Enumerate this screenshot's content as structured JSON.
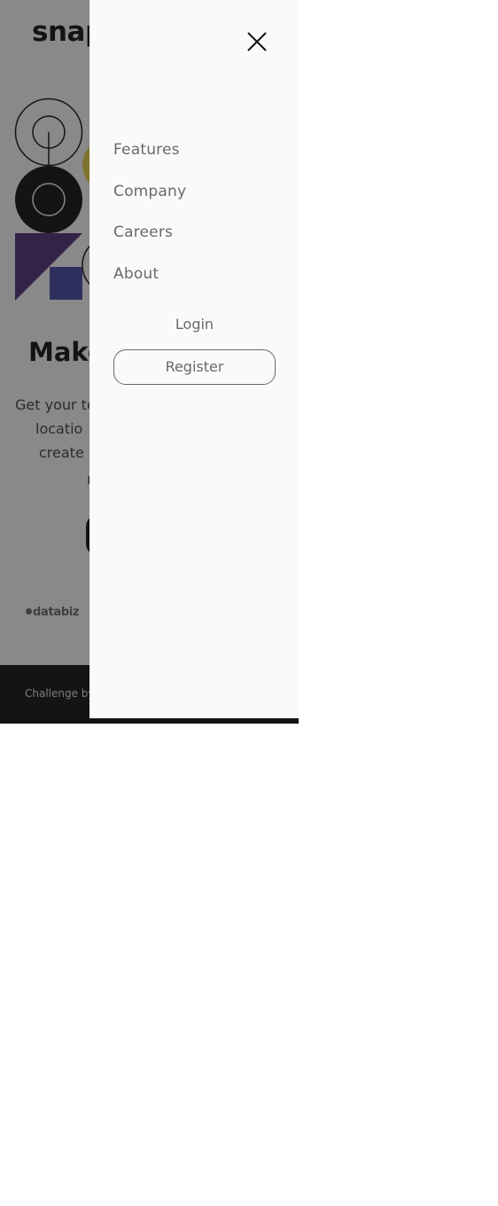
{
  "brand": {
    "logo_text": "snap"
  },
  "hero": {
    "title": "Make",
    "text_lines": [
      "Get your te",
      "locatio",
      "create",
      "r"
    ]
  },
  "clients": {
    "first": "databiz"
  },
  "footer": {
    "text": "Challenge by"
  },
  "menu": {
    "close_icon": "close-icon",
    "items": [
      {
        "label": "Features"
      },
      {
        "label": "Company"
      },
      {
        "label": "Careers"
      },
      {
        "label": "About"
      }
    ],
    "login_label": "Login",
    "register_label": "Register"
  },
  "colors": {
    "overlay": "#141414",
    "drawer_bg": "#fafafa",
    "text_muted": "#696969",
    "accent_purple": "#56307a",
    "accent_blue": "#4b4ba8",
    "accent_yellow": "#e8d44d"
  }
}
